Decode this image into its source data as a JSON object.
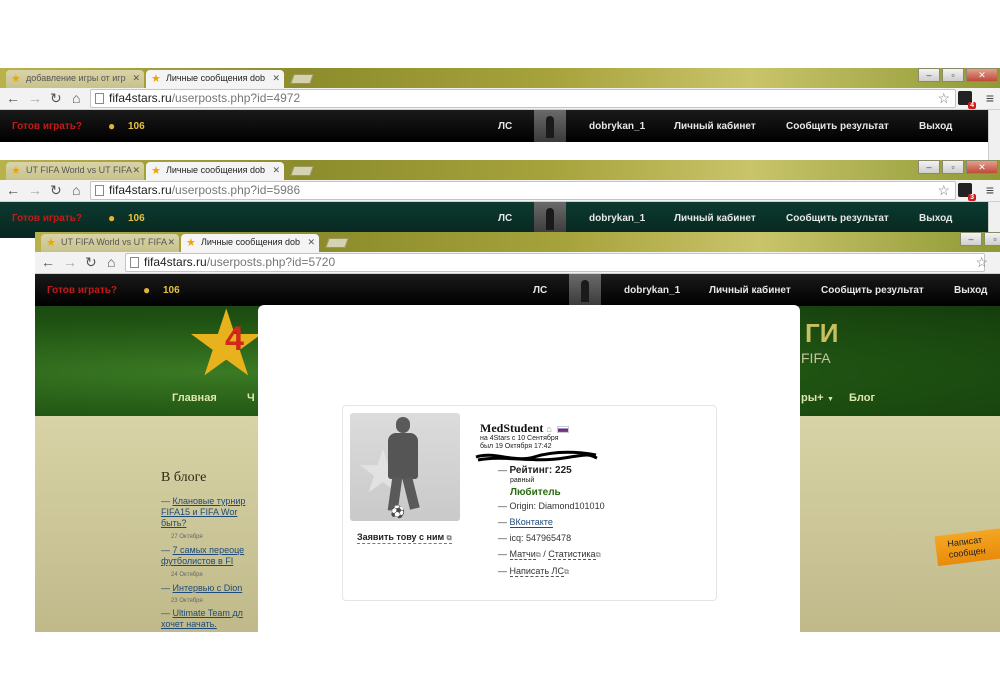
{
  "windows": [
    {
      "tabs": [
        {
          "title": "добавление игры от игр"
        },
        {
          "title": "Личные сообщения dob"
        }
      ],
      "url_host": "fifa4stars.ru",
      "url_path": "/userposts.php?id=4972",
      "ext_badge": "4"
    },
    {
      "tabs": [
        {
          "title": "UT FIFA World vs UT FIFA"
        },
        {
          "title": "Личные сообщения dob"
        }
      ],
      "url_host": "fifa4stars.ru",
      "url_path": "/userposts.php?id=5986",
      "ext_badge": "3"
    },
    {
      "tabs": [
        {
          "title": "UT FIFA World vs UT FIFA"
        },
        {
          "title": "Личные сообщения dob"
        }
      ],
      "url_host": "fifa4stars.ru",
      "url_path": "/userposts.php?id=5720"
    }
  ],
  "site_bar": {
    "ready_label": "Готов играть?",
    "coins": "106",
    "ls_label": "ЛС",
    "username": "dobrykan_1",
    "cabinet_label": "Личный кабинет",
    "report_label": "Сообщить результат",
    "logout_label": "Выход"
  },
  "main_nav": {
    "home": "Главная",
    "home_partial": "Ч",
    "more_partial": "ры+",
    "blog": "Блог"
  },
  "header_partial": {
    "logo_digit": "4",
    "title_tail": "ГИ",
    "subtitle_tail": "FIFA"
  },
  "blog": {
    "title": "В блоге",
    "items": [
      {
        "text": "Клановые турнир FIFA15 и FIFA Wor быть?",
        "date": "27 Октября"
      },
      {
        "text": "7 самых переоце футболистов в FI",
        "date": "24 Октября"
      },
      {
        "text": "Интервью с Dion",
        "date": "23 Октября"
      },
      {
        "text": "Ultimate Team дл хочет начать.",
        "date": ""
      }
    ]
  },
  "sticker": {
    "line1": "Написат",
    "line2": "сообщен"
  },
  "profile": {
    "name": "MedStudent",
    "joined": "на 4Stars с 10 Сентября",
    "last_seen": "был 19 Октября 17:42",
    "rating": "Рейтинг: 225",
    "rating_note": "равный",
    "level": "Любитель",
    "origin": "Origin: Diamond101010",
    "vk": "ВКонтакте",
    "icq": "icq: 547965478",
    "matches": "Матчи",
    "stats": "Статистика",
    "write_ls": "Написать ЛС",
    "challenge": "Заявить тову с ним"
  },
  "colors": {
    "accent_green": "#2b6a12",
    "ready_red": "#c51a1a",
    "coin_gold": "#e6c240"
  }
}
